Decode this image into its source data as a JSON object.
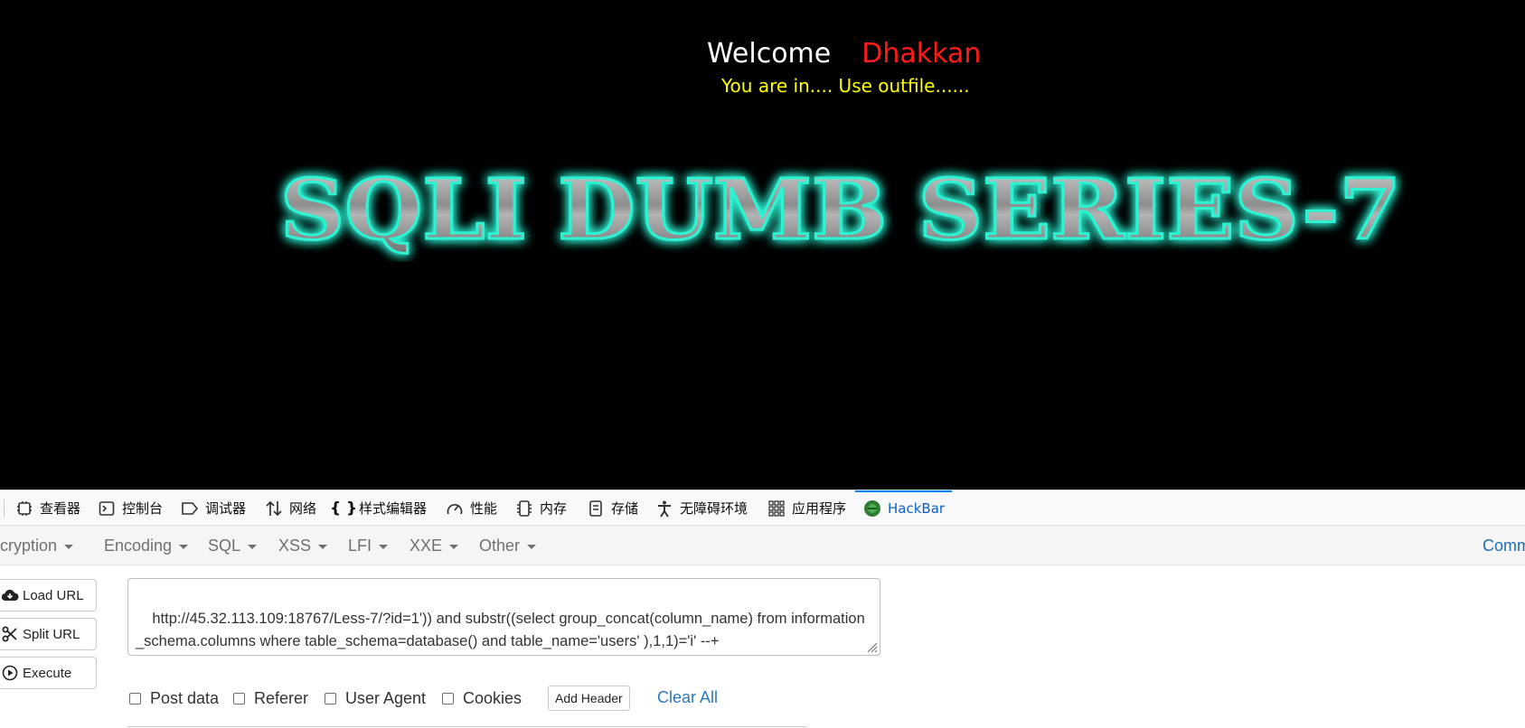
{
  "page": {
    "welcome": "Welcome",
    "user": "Dhakkan",
    "status": "You are in.... Use outfile......",
    "banner": "SQLI DUMB SERIES-7"
  },
  "devtools": {
    "tabs": [
      {
        "label": "查看器",
        "icon": "inspector-icon"
      },
      {
        "label": "控制台",
        "icon": "console-icon"
      },
      {
        "label": "调试器",
        "icon": "debugger-icon"
      },
      {
        "label": "网络",
        "icon": "network-icon"
      },
      {
        "label": "样式编辑器",
        "icon": "style-editor-icon"
      },
      {
        "label": "性能",
        "icon": "performance-icon"
      },
      {
        "label": "内存",
        "icon": "memory-icon"
      },
      {
        "label": "存储",
        "icon": "storage-icon"
      },
      {
        "label": "无障碍环境",
        "icon": "accessibility-icon"
      },
      {
        "label": "应用程序",
        "icon": "application-icon"
      },
      {
        "label": "HackBar",
        "icon": "hackbar-icon",
        "active": true
      }
    ]
  },
  "hackbar": {
    "menu": [
      "Encryption",
      "Encoding",
      "SQL",
      "XSS",
      "LFI",
      "XXE",
      "Other"
    ],
    "right_link": "Comm",
    "buttons": {
      "load_url": "Load URL",
      "split_url": "Split URL",
      "execute": "Execute"
    },
    "url_value": "http://45.32.113.109:18767/Less-7/?id=1')) and substr((select group_concat(column_name) from information_schema.columns where table_schema=database() and table_name='users' ),1,1)='i' --+",
    "options": {
      "post_data": "Post data",
      "referer": "Referer",
      "user_agent": "User Agent",
      "cookies": "Cookies"
    },
    "add_header": "Add Header",
    "clear_all": "Clear All"
  },
  "colors": {
    "page_background": "#000000",
    "user_name": "#ff1a1a",
    "status_text": "#ffff00",
    "banner_glow": "#2ef2d2",
    "active_tab": "#0a60c8",
    "link": "#2b78c2"
  }
}
